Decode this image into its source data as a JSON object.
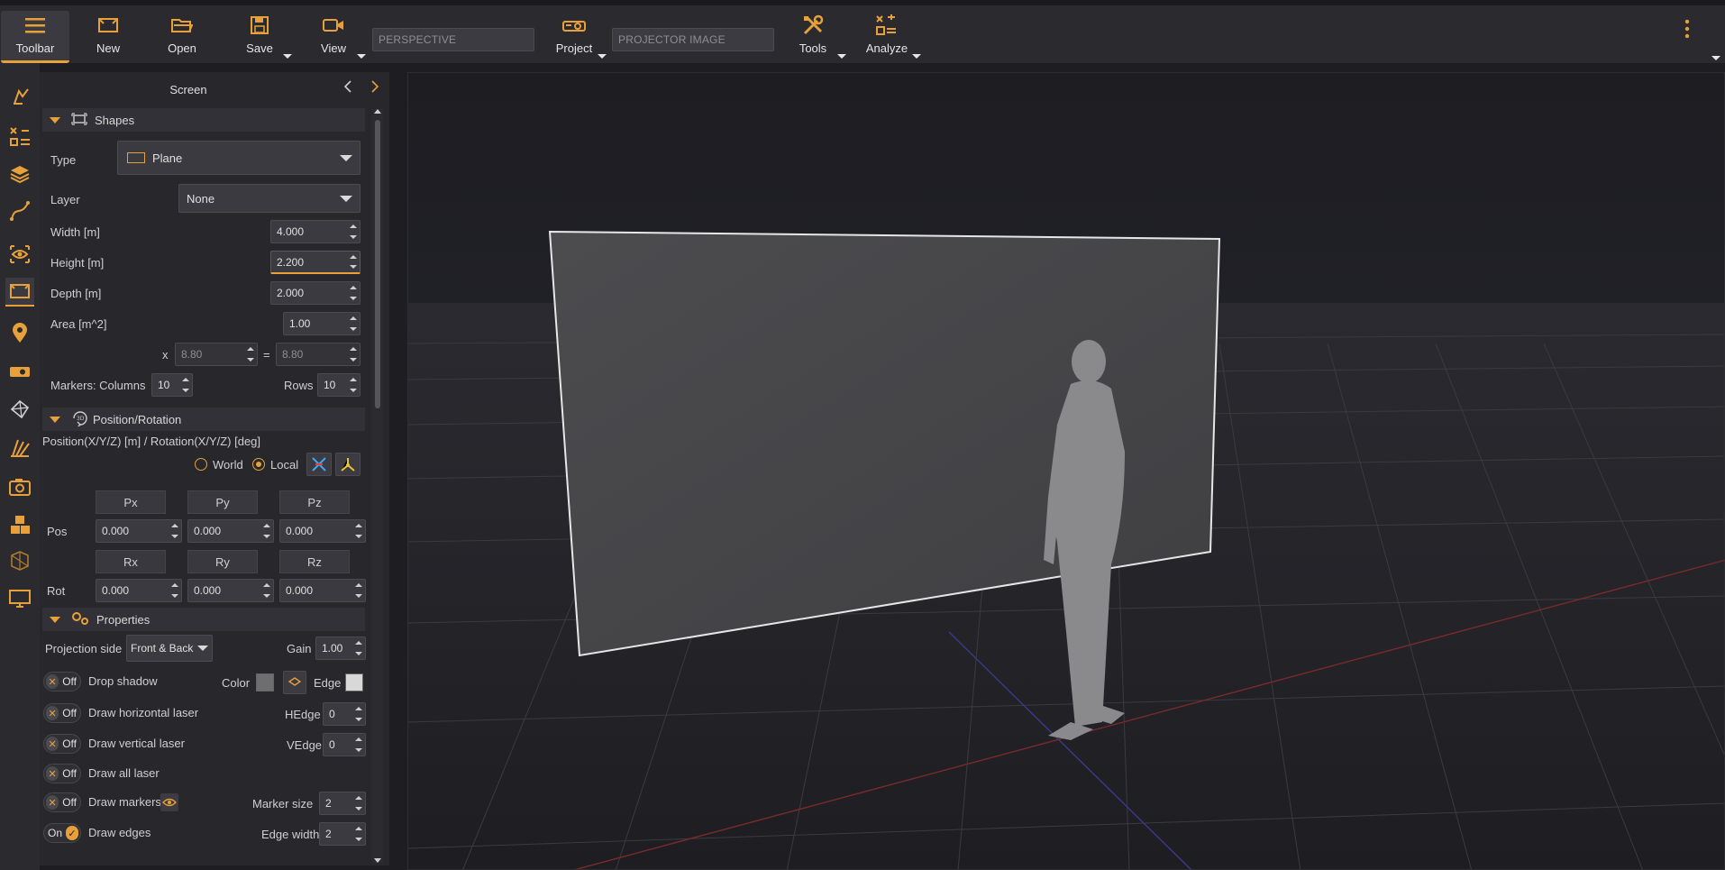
{
  "toolbar": {
    "toolbar_label": "Toolbar",
    "new_label": "New",
    "open_label": "Open",
    "save_label": "Save",
    "view_label": "View",
    "view_field": "PERSPECTIVE",
    "project_label": "Project",
    "project_field": "PROJECTOR IMAGE",
    "tools_label": "Tools",
    "analyze_label": "Analyze"
  },
  "colors": {
    "accent": "#e8a13a",
    "panel_bg": "#27272c",
    "toolbar_bg": "#2a2a2f"
  },
  "sidebar_icons": [
    "pointer-icon",
    "scene-objects-icon",
    "layers-icon",
    "curve-icon",
    "eye-icon",
    "screen-icon",
    "location-pin-icon",
    "projector-icon",
    "geometry-icon",
    "laser-icon",
    "camera-icon",
    "cubes-icon",
    "calibration-icon",
    "display-icon"
  ],
  "panel": {
    "title": "Screen",
    "shapes": {
      "section_label": "Shapes",
      "type_label": "Type",
      "type_value": "Plane",
      "layer_label": "Layer",
      "layer_value": "None",
      "width_label": "Width  [m]",
      "width_value": "4.000",
      "height_label": "Height  [m]",
      "height_value": "2.200",
      "depth_label": "Depth  [m]",
      "depth_value": "2.000",
      "area_label": "Area  [m^2]",
      "area_value": "1.00",
      "mult_x": "x",
      "mult_a": "8.80",
      "eq": "=",
      "mult_b": "8.80",
      "markers_label": "Markers:  Columns",
      "columns_value": "10",
      "rows_label": "Rows",
      "rows_value": "10"
    },
    "position": {
      "section_label": "Position/Rotation",
      "caption": "Position(X/Y/Z) [m] / Rotation(X/Y/Z) [deg]",
      "world_label": "World",
      "local_label": "Local",
      "px": "Px",
      "py": "Py",
      "pz": "Pz",
      "pos_label": "Pos",
      "pos_x": "0.000",
      "pos_y": "0.000",
      "pos_z": "0.000",
      "rx": "Rx",
      "ry": "Ry",
      "rz": "Rz",
      "rot_label": "Rot",
      "rot_x": "0.000",
      "rot_y": "0.000",
      "rot_z": "0.000"
    },
    "properties": {
      "section_label": "Properties",
      "projection_side_label": "Projection side",
      "projection_side_value": "Front & Back",
      "gain_label": "Gain",
      "gain_value": "1.00",
      "off": "Off",
      "on": "On",
      "drop_shadow": "Drop shadow",
      "color_label": "Color",
      "edge_label": "Edge",
      "draw_h_laser": "Draw horizontal laser",
      "hedge_label": "HEdge",
      "hedge_value": "0",
      "draw_v_laser": "Draw vertical laser",
      "vedge_label": "VEdge",
      "vedge_value": "0",
      "draw_all_laser": "Draw all laser",
      "draw_markers": "Draw markers",
      "marker_size_label": "Marker size",
      "marker_size_value": "2",
      "draw_edges": "Draw edges",
      "edge_width_label": "Edge width",
      "edge_width_value": "2"
    }
  }
}
